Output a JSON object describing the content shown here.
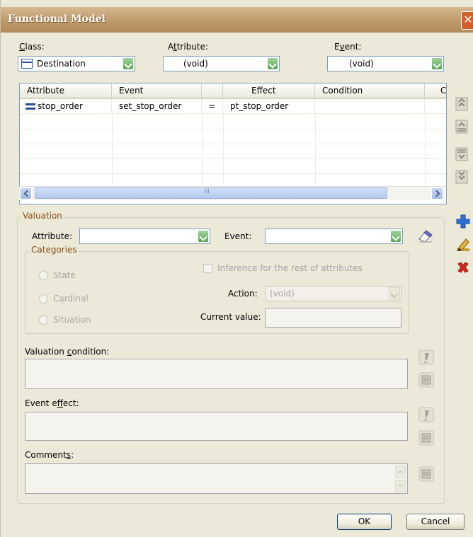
{
  "window": {
    "title": "Functional Model",
    "close_glyph": "✕"
  },
  "top": {
    "class_label_first": "C",
    "class_label_rest": "lass:",
    "attribute_label_a": "A",
    "attribute_label_u": "t",
    "attribute_label_rest": "tribute:",
    "event_label_a": "E",
    "event_label_u": "v",
    "event_label_rest": "ent:",
    "class_value": "Destination",
    "attribute_value": "(void)",
    "event_value": "(void)"
  },
  "table": {
    "columns": [
      "Attribute",
      "Event",
      "",
      "Effect",
      "Condition",
      "Cu"
    ],
    "rows": [
      {
        "attribute": "stop_order",
        "event": "set_stop_order",
        "op": "=",
        "effect": "pt_stop_order",
        "condition": "",
        "cu": ""
      }
    ],
    "scroll_grip": "III"
  },
  "valuation": {
    "group_label": "Valuation",
    "attribute_label": "Attribute:",
    "event_label": "Event:",
    "attribute_value": "",
    "event_value": "",
    "categories_label": "Categories",
    "radios": [
      "State",
      "Cardinal",
      "Situation"
    ],
    "inference_label": "Inference for the rest of attributes",
    "action_label": "Action:",
    "action_value": "(void)",
    "current_value_label": "Current value:",
    "current_value": ""
  },
  "fields": {
    "valuation_condition_a": "Valuation ",
    "valuation_condition_u": "c",
    "valuation_condition_b": "ondition:",
    "event_effect_a": "Event e",
    "event_effect_u": "f",
    "event_effect_b": "fect:",
    "comments_a": "Comment",
    "comments_u": "s",
    "comments_b": ":",
    "valuation_condition_value": "",
    "event_effect_value": "",
    "comments_value": ""
  },
  "buttons": {
    "ok": "OK",
    "cancel": "Cancel"
  },
  "colors": {
    "accent_blue": "#2b6fd6",
    "delete_red": "#d42a1e",
    "title_bar": "#c09a6a"
  }
}
